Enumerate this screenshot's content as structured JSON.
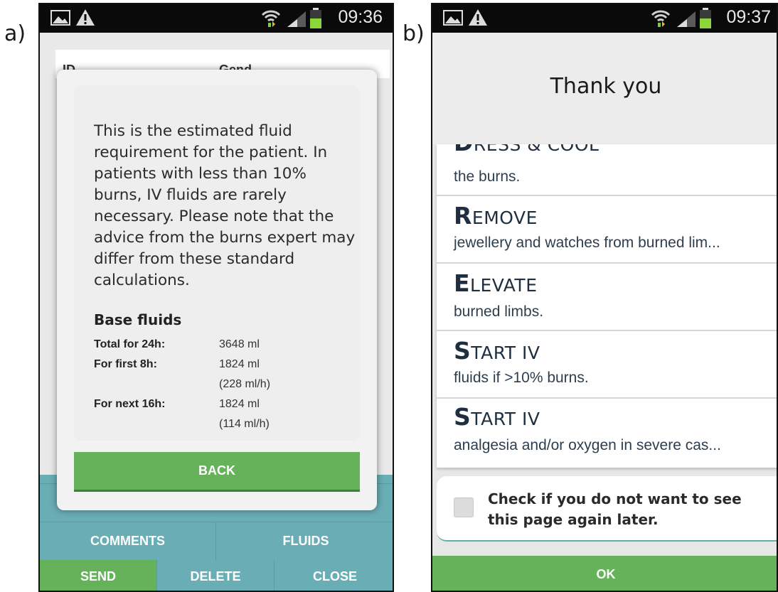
{
  "panel_labels": {
    "a": "a)",
    "b": "b)"
  },
  "phone_a": {
    "status_time": "09:36",
    "behind_col1": "ID",
    "behind_col2": "Gend",
    "dialog": {
      "message": "This is the estimated fluid requirement for the patient. In patients with less than 10% burns, IV fluids are rarely necessary. Please note that the advice from the burns expert may differ from these standard calculations.",
      "section_title": "Base fluids",
      "rows": [
        {
          "label": "Total for 24h:",
          "value": "3648 ml",
          "rate": ""
        },
        {
          "label": "For first 8h:",
          "value": "1824 ml",
          "rate": "(228 ml/h)"
        },
        {
          "label": "For next 16h:",
          "value": "1824 ml",
          "rate": "(114 ml/h)"
        }
      ],
      "back_label": "BACK"
    },
    "buttons": {
      "comments": "COMMENTS",
      "fluids": "FLUIDS",
      "send": "SEND",
      "delete": "DELETE",
      "close": "CLOSE"
    },
    "colors": {
      "teal": "#6aaeb5",
      "green": "#66b25b"
    }
  },
  "phone_b": {
    "status_time": "09:37",
    "header_title": "Thank you",
    "items": [
      {
        "cap": "D",
        "rest": "RESS & COOL",
        "desc": "the burns."
      },
      {
        "cap": "R",
        "rest": "EMOVE",
        "desc": "jewellery and watches from burned lim..."
      },
      {
        "cap": "E",
        "rest": "LEVATE",
        "desc": "burned limbs."
      },
      {
        "cap": "S",
        "rest": "TART IV",
        "desc": "fluids if >10% burns."
      },
      {
        "cap": "S",
        "rest": "TART IV",
        "desc": "analgesia and/or oxygen in severe cas..."
      }
    ],
    "checkbox_label": "Check if you do not want to see this page again later.",
    "ok_label": "OK"
  },
  "icons": [
    "image-icon",
    "warning-icon",
    "wifi-icon",
    "signal-icon",
    "battery-icon"
  ]
}
